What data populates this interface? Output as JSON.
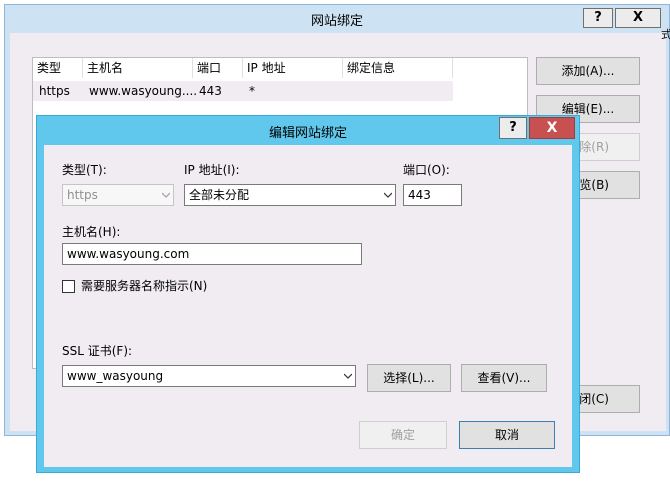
{
  "bg_window": {
    "title": "网站绑定",
    "help_label": "?",
    "close_label": "X",
    "list_headers": [
      "类型",
      "主机名",
      "端口",
      "IP 地址",
      "绑定信息"
    ],
    "list_row": [
      "https",
      "www.wasyoung....",
      "443",
      "*",
      ""
    ],
    "buttons": {
      "add": "添加(A)...",
      "edit": "编辑(E)...",
      "remove_fragment": "除(R)",
      "browse_fragment": "览(B)",
      "close_fragment": "闭(C)"
    },
    "right_edge_char": "式"
  },
  "dialog": {
    "title": "编辑网站绑定",
    "help_label": "?",
    "close_label": "X",
    "type_label": "类型(T):",
    "type_value": "https",
    "ip_label": "IP 地址(I):",
    "ip_value": "全部未分配",
    "port_label": "端口(O):",
    "port_value": "443",
    "hostname_label": "主机名(H):",
    "hostname_value": "www.wasyoung.com",
    "sni_label": "需要服务器名称指示(N)",
    "ssl_label": "SSL 证书(F):",
    "ssl_value": "www_wasyoung",
    "select_btn": "选择(L)...",
    "view_btn": "查看(V)...",
    "ok_btn": "确定",
    "cancel_btn": "取消"
  }
}
